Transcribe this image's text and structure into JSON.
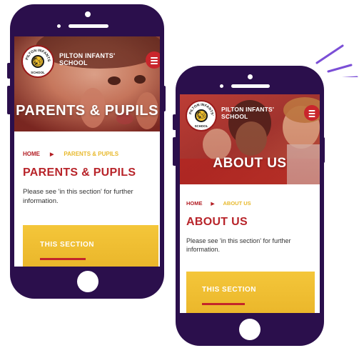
{
  "colors": {
    "phone": "#2b0f4c",
    "accent_red": "#b8242a",
    "accent_yellow": "#f2c12e",
    "deco_purple": "#7b4fd6"
  },
  "logo": {
    "text": "PILTON INFANTS' SCHOOL",
    "icon": "squirrel-icon"
  },
  "phone_left": {
    "school_name_line1": "PILTON INFANTS'",
    "school_name_line2": "SCHOOL",
    "hero_title": "PARENTS & PUPILS",
    "breadcrumb": {
      "home": "HOME",
      "separator": "▶",
      "current": "PARENTS & PUPILS"
    },
    "page_title": "PARENTS & PUPILS",
    "description": "Please see 'in this section' for further information.",
    "section_label": "THIS SECTION"
  },
  "phone_right": {
    "school_name_line1": "PILTON INFANTS'",
    "school_name_line2": "SCHOOL",
    "hero_title": "ABOUT US",
    "breadcrumb": {
      "home": "HOME",
      "separator": "▶",
      "current": "ABOUT US"
    },
    "page_title": "ABOUT US",
    "description": "Please see 'in this section' for further information.",
    "section_label": "THIS SECTION"
  }
}
